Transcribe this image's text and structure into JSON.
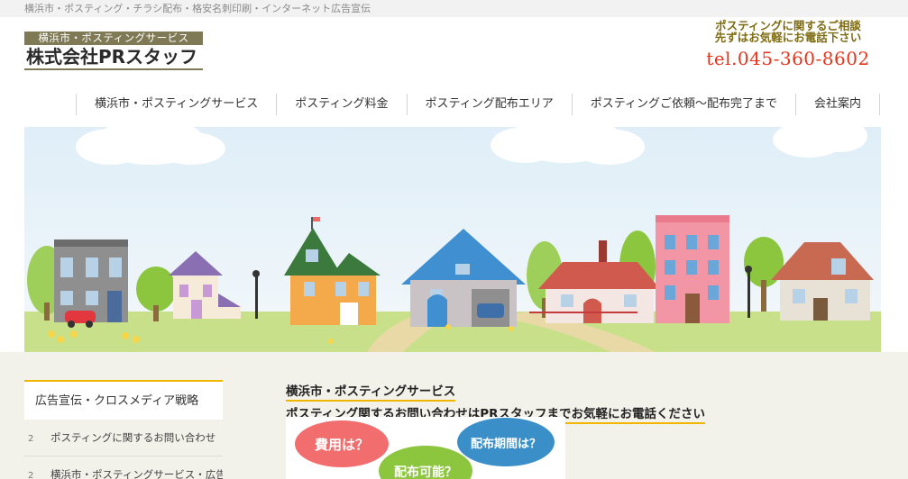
{
  "topbar": {
    "text": "横浜市・ポスティング・チラシ配布・格安名刺印刷・インターネット広告宣伝"
  },
  "logo": {
    "tagline": "横浜市・ポスティングサービス",
    "company": "株式会社PRスタッフ"
  },
  "contact": {
    "line1": "ポスティングに関するご相談",
    "line2": "先ずはお気軽にお電話下さい",
    "tel": "tel.045-360-8602"
  },
  "nav": {
    "items": [
      "横浜市・ポスティングサービス",
      "ポスティング料金",
      "ポスティング配布エリア",
      "ポスティングご依頼〜配布完了まで",
      "会社案内"
    ]
  },
  "sidebar": {
    "heading": "広告宣伝・クロスメディア戦略",
    "items": [
      {
        "bullet": "2",
        "label": "ポスティングに関するお問い合わせ"
      },
      {
        "bullet": "2",
        "label": "横浜市・ポスティングサービス・広告"
      }
    ]
  },
  "content": {
    "heading1": "横浜市・ポスティングサービス",
    "heading2": "ポスティング関するお問い合わせはPRスタッフまでお気軽にお電話ください",
    "bubbles": [
      "費用は？",
      "配布可能？",
      "配布期間は？"
    ]
  },
  "colors": {
    "accent": "#f2b600",
    "logo_band": "#7f7a55",
    "tel": "#e8341c",
    "bubble_pink": "#f26d6d",
    "bubble_green": "#8cc63f",
    "bubble_blue": "#3a8fc9"
  }
}
